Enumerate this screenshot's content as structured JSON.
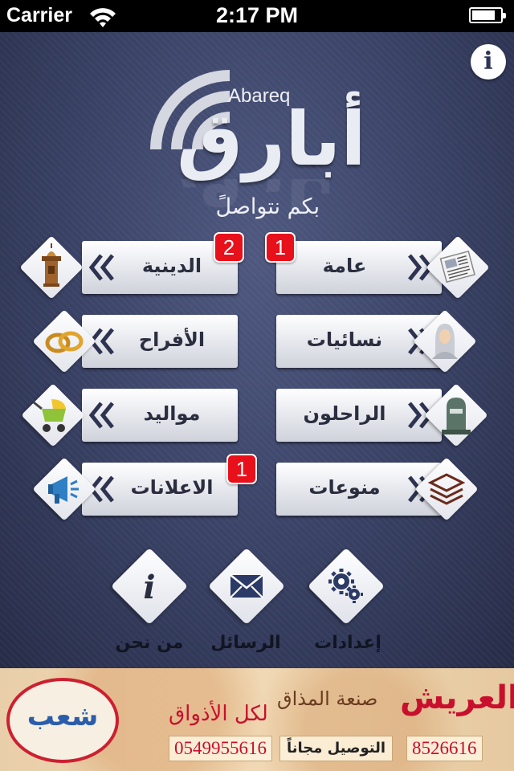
{
  "status_bar": {
    "carrier": "Carrier",
    "time": "2:17 PM"
  },
  "header": {
    "logo_en": "Abareq",
    "logo_ar": "أبارق",
    "tagline": "بكم نتواصلً",
    "info_icon": "info-icon"
  },
  "grid": {
    "left": [
      {
        "label": "الدينية",
        "icon": "minaret-icon"
      },
      {
        "label": "الأفراح",
        "icon": "rings-icon"
      },
      {
        "label": "مواليد",
        "icon": "stroller-icon"
      },
      {
        "label": "الاعلانات",
        "icon": "megaphone-icon"
      }
    ],
    "right": [
      {
        "label": "عامة",
        "icon": "newspaper-icon"
      },
      {
        "label": "نسائيات",
        "icon": "woman-icon"
      },
      {
        "label": "الراحلون",
        "icon": "gravestone-icon"
      },
      {
        "label": "منوعات",
        "icon": "layers-icon"
      }
    ]
  },
  "badges": {
    "religious": "2",
    "general": "1",
    "ads": "1"
  },
  "bottom_nav": [
    {
      "label": "من نحن",
      "icon": "info-icon"
    },
    {
      "label": "الرسائل",
      "icon": "envelope-icon"
    },
    {
      "label": "إعدادات",
      "icon": "gears-icon"
    }
  ],
  "ad": {
    "logo_text": "شعب",
    "title": "العريش",
    "subtitle1": "صنعة المذاق",
    "subtitle2": "لكل الأذواق",
    "phone1": "0549955616",
    "delivery": "التوصيل مجاناً",
    "phone2": "8526616"
  },
  "colors": {
    "panel": "#3a4266",
    "badge": "#e8101a",
    "ad_red": "#c8102e"
  }
}
